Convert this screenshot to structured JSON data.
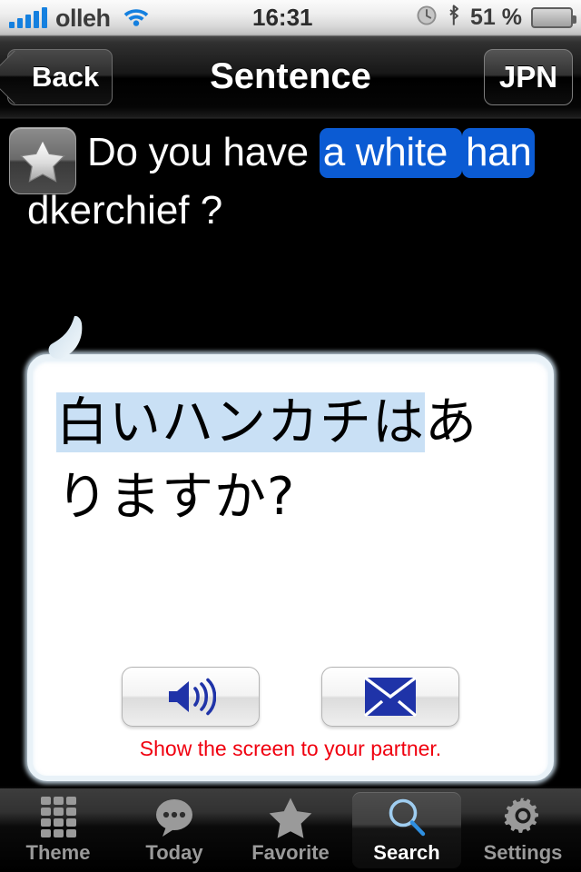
{
  "status_bar": {
    "carrier": "olleh",
    "time": "16:31",
    "battery_percent": "51 %",
    "battery_level": 51,
    "signal_bars": 5,
    "icons": [
      "signal-bars-icon",
      "wifi-icon",
      "alarm-clock-icon",
      "bluetooth-icon",
      "battery-icon"
    ]
  },
  "nav_bar": {
    "back_label": "Back",
    "title": "Sentence",
    "language_label": "JPN"
  },
  "sentence": {
    "favorite_icon": "star-icon",
    "line1_plain": "Do you have ",
    "line1_hl1": "a white ",
    "line1_hl2": "han",
    "line2_hl": "dkerchief",
    "line2_tail": " ?",
    "full_text": "Do you have a white handkerchief ?",
    "highlight_color": "#0b5bd3"
  },
  "bubble": {
    "jp_plain_pre": "",
    "jp_hl1": "白い",
    "jp_hl2": "ハンカチは",
    "jp_rest": "ありますか?",
    "jp_full": "白いハンカチはありますか?",
    "highlight_color": "#c9e0f5",
    "speak_button": "speaker-icon",
    "mail_button": "envelope-icon",
    "note": "Show the screen to your partner.",
    "note_color": "#f0000f"
  },
  "tab_bar": {
    "selected": "Search",
    "items": [
      {
        "label": "Theme",
        "icon": "grid-icon"
      },
      {
        "label": "Today",
        "icon": "speech-bubble-icon"
      },
      {
        "label": "Favorite",
        "icon": "star-icon"
      },
      {
        "label": "Search",
        "icon": "magnifier-icon"
      },
      {
        "label": "Settings",
        "icon": "gear-icon"
      }
    ]
  }
}
